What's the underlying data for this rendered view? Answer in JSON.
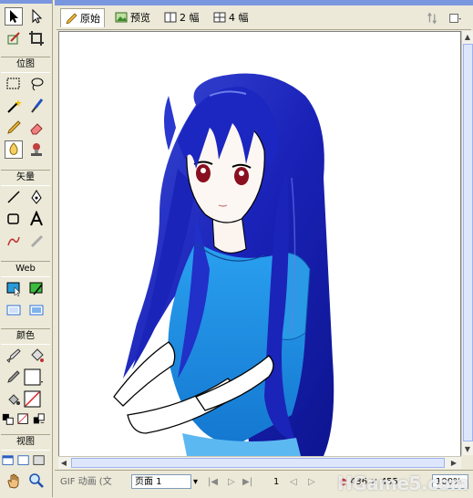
{
  "tools_panel": {
    "sections": [
      {
        "label": "位图"
      },
      {
        "label": "矢量"
      },
      {
        "label": "Web"
      },
      {
        "label": "颜色"
      },
      {
        "label": "视图"
      }
    ]
  },
  "document_tabs": {
    "tabs": [
      {
        "label": "原始"
      },
      {
        "label": "预览"
      },
      {
        "label": "2 幅"
      },
      {
        "label": "4 幅"
      }
    ]
  },
  "status_bar": {
    "gif_label": "GIF 动画 (文",
    "page_label": "页面 1",
    "frame_number": "1",
    "size_readout": "436 × 455",
    "zoom": "100%",
    "watermark": "HGame5.com"
  },
  "colors": {
    "accent": "#7a96df",
    "panel_bg": "#ece9d8",
    "hair": "#1a2bb0",
    "dress": "#1e90e6"
  }
}
